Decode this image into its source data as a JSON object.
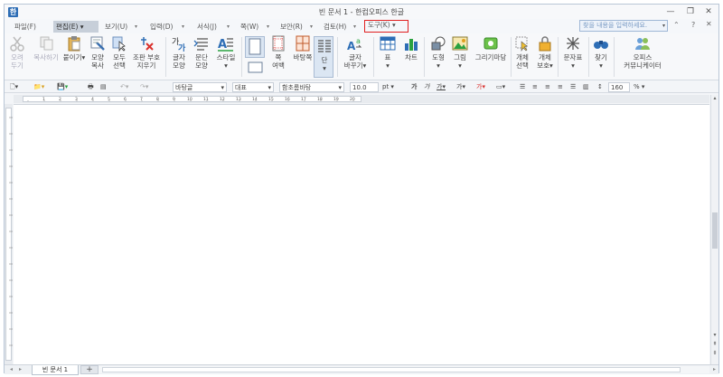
{
  "title": "빈 문서 1 - 한컴오피스 한글",
  "menu": [
    {
      "label": "파일(F)"
    },
    {
      "label": "편집(E)",
      "active": true
    },
    {
      "label": "보기(U)"
    },
    {
      "label": "입력(D)"
    },
    {
      "label": "서식(J)"
    },
    {
      "label": "쪽(W)"
    },
    {
      "label": "보안(R)"
    },
    {
      "label": "검토(H)"
    },
    {
      "label": "도구(K)",
      "highlight": true
    }
  ],
  "search_placeholder": "찾을 내용을 입력하세요.",
  "ribbon": {
    "cut": "오려\n두기",
    "copy": "복사하기",
    "paste": "붙이기",
    "format_copy": "모양\n복사",
    "select_all": "모두\n선택",
    "clear_codes": "조판 부호\n지우기",
    "char_shape": "글자\n모양",
    "para_shape": "문단\n모양",
    "style": "스타일",
    "margin": "쪽\n여백",
    "background": "바탕쪽",
    "columns": "단",
    "change_case": "글자\n바꾸기",
    "table": "표",
    "chart": "차트",
    "shape": "도형",
    "picture": "그림",
    "draw_madang": "그리기마당",
    "object_select": "개체\n선택",
    "object_protect": "개체\n보호",
    "char_map": "문자표",
    "find": "찾기",
    "office_communicator": "오피스\n커뮤니케이터"
  },
  "format": {
    "style": "바탕글",
    "lang": "대표",
    "font": "함초롬바탕",
    "size": "10.0",
    "unit": "pt",
    "zoom": "160",
    "zoom_unit": "%"
  },
  "tabs": {
    "doc_tab": "빈 문서 1",
    "add": "+"
  },
  "colors": {
    "highlight_border": "#e02020",
    "accent": "#2d6db5"
  }
}
